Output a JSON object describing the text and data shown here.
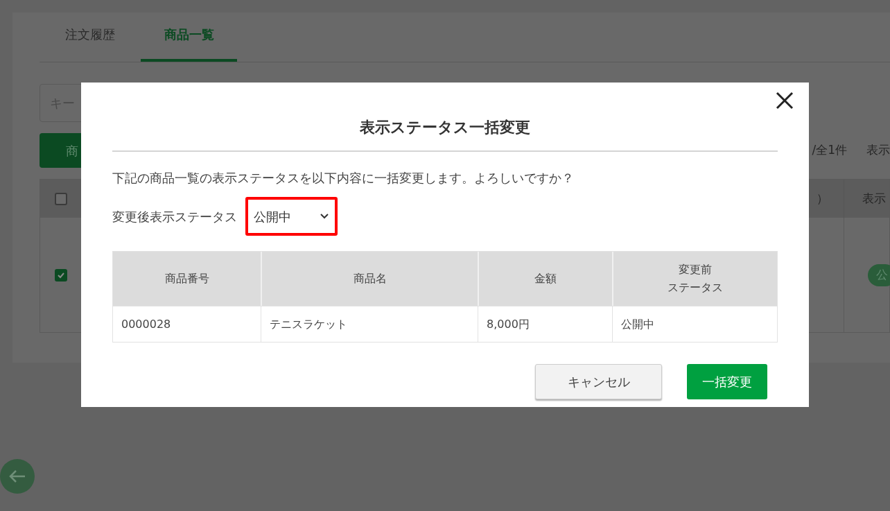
{
  "background": {
    "tabs": [
      {
        "label": "注文履歴",
        "selected": false
      },
      {
        "label": "商品一覧",
        "selected": true
      }
    ],
    "search": {
      "placeholder": "キー"
    },
    "button": "商",
    "summary": "/全1件",
    "summary_2": "表示",
    "table": {
      "header_checkbox": {
        "checked": false
      },
      "columns": [
        "）",
        "表示"
      ],
      "row": {
        "checked": true,
        "badge": "公"
      }
    }
  },
  "dialog": {
    "title": "表示ステータス一括変更",
    "message": "下記の商品一覧の表示ステータスを以下内容に一括変更します。よろしいですか？",
    "field": {
      "label": "変更後表示ステータス",
      "value": "公開中",
      "highlighted": true
    },
    "table": {
      "columns": [
        {
          "label": "商品番号"
        },
        {
          "label": "商品名"
        },
        {
          "label": "金額"
        },
        {
          "label": "変更前",
          "label_2": "ステータス"
        }
      ],
      "rows": [
        [
          "0000028",
          "テニスラケット",
          "8,000円",
          "公開中"
        ]
      ]
    },
    "buttons": [
      {
        "label": "キャンセル",
        "kind": "secondary"
      },
      {
        "label": "一括変更",
        "kind": "primary"
      }
    ]
  }
}
